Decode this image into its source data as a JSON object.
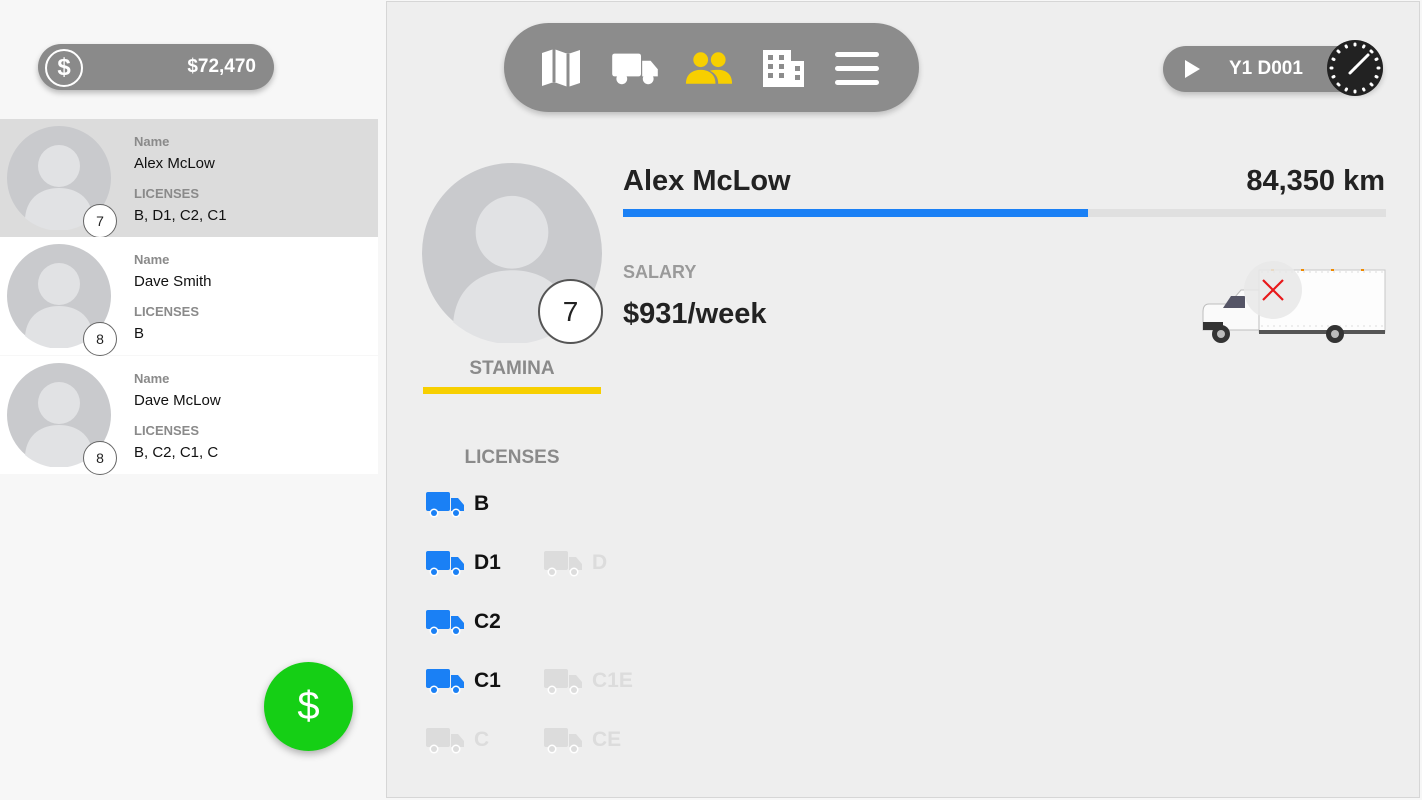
{
  "money": {
    "amount": "$72,470",
    "icon": "dollar-coin-icon"
  },
  "drivers": [
    {
      "name_label": "Name",
      "name": "Alex McLow",
      "licenses_label": "LICENSES",
      "licenses": "B, D1, C2, C1",
      "level": "7",
      "selected": true
    },
    {
      "name_label": "Name",
      "name": "Dave Smith",
      "licenses_label": "LICENSES",
      "licenses": "B",
      "level": "8",
      "selected": false
    },
    {
      "name_label": "Name",
      "name": "Dave McLow",
      "licenses_label": "LICENSES",
      "licenses": "B, C2, C1, C",
      "level": "8",
      "selected": false
    }
  ],
  "fab": {
    "symbol": "$",
    "icon": "dollar-icon",
    "color": "#15cf15"
  },
  "nav": {
    "items": [
      {
        "icon": "map-icon",
        "active": false
      },
      {
        "icon": "truck-icon",
        "active": false
      },
      {
        "icon": "people-icon",
        "active": true
      },
      {
        "icon": "building-icon",
        "active": false
      },
      {
        "icon": "menu-icon",
        "active": false
      }
    ],
    "active_color": "#f7cf00"
  },
  "time": {
    "date": "Y1 D001",
    "icon": "clock-icon"
  },
  "detail": {
    "name": "Alex McLow",
    "distance": "84,350 km",
    "distance_progress": 0.61,
    "level": "7",
    "stamina_label": "STAMINA",
    "stamina_color": "#f7cf00",
    "salary_label": "SALARY",
    "salary": "$931/week",
    "accent": "#1a80f5"
  },
  "licenses": {
    "header": "LICENSES",
    "items": [
      {
        "code": "B",
        "held": true
      },
      {
        "code": "D1",
        "held": true
      },
      {
        "code": "D",
        "held": false
      },
      {
        "code": "C2",
        "held": true
      },
      {
        "code": "C1",
        "held": true
      },
      {
        "code": "C1E",
        "held": false
      },
      {
        "code": "C",
        "held": false
      },
      {
        "code": "CE",
        "held": false
      }
    ]
  }
}
